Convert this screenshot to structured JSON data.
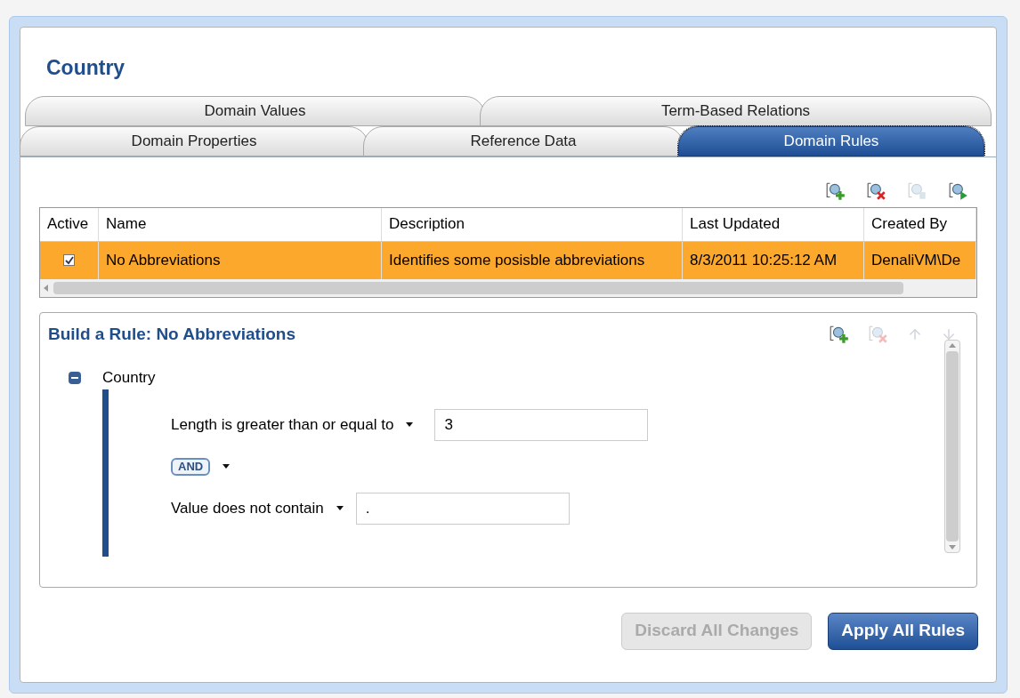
{
  "title": "Country",
  "tab_rows": [
    [
      {
        "label": "Domain Values",
        "selected": false
      },
      {
        "label": "Term-Based Relations",
        "selected": false
      }
    ],
    [
      {
        "label": "Domain Properties",
        "selected": false
      },
      {
        "label": "Reference Data",
        "selected": false
      },
      {
        "label": "Domain Rules",
        "selected": true
      }
    ]
  ],
  "rules_toolbar": [
    {
      "kind": "add",
      "disabled": false
    },
    {
      "kind": "delete",
      "disabled": false
    },
    {
      "kind": "copy",
      "disabled": true
    },
    {
      "kind": "run",
      "disabled": false
    }
  ],
  "table": {
    "columns": [
      "Active",
      "Name",
      "Description",
      "Last Updated",
      "Created By"
    ],
    "rows": [
      {
        "selected": true,
        "cells": [
          {
            "kind": "checkbox",
            "checked": true
          },
          "No Abbreviations",
          "Identifies some posisble abbreviations",
          "8/3/2011 10:25:12 AM",
          "DenaliVM\\De"
        ]
      }
    ]
  },
  "builder": {
    "title": "Build a Rule: No Abbreviations",
    "toolbar": [
      {
        "kind": "add",
        "disabled": false
      },
      {
        "kind": "delete",
        "disabled": true
      },
      {
        "kind": "up",
        "disabled": true
      },
      {
        "kind": "down",
        "disabled": true
      }
    ],
    "node": {
      "label": "Country",
      "expanded": true,
      "children": [
        {
          "kind": "condition",
          "label": "Length is greater than or equal to",
          "value": "3"
        },
        {
          "kind": "operator",
          "label": "AND"
        },
        {
          "kind": "condition",
          "label": "Value does not contain",
          "value": "."
        }
      ]
    }
  },
  "buttons": [
    {
      "label": "Discard All Changes",
      "disabled": true
    },
    {
      "label": "Apply All Rules",
      "disabled": false
    }
  ]
}
